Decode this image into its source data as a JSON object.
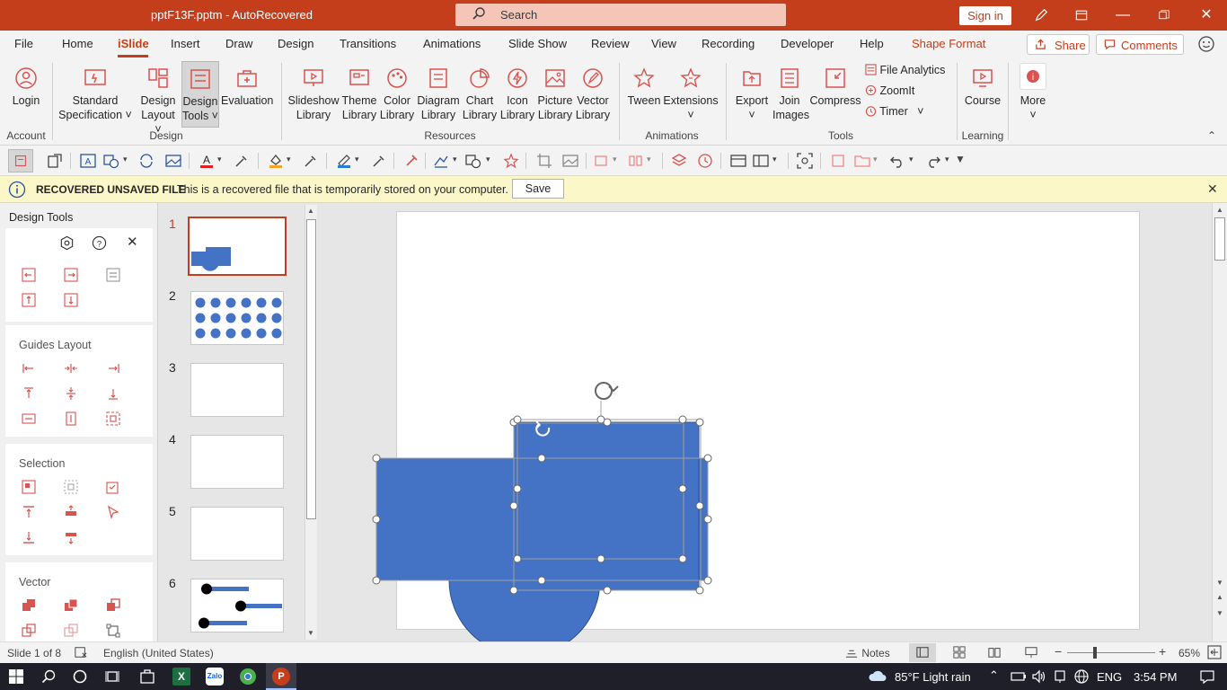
{
  "titlebar": {
    "doc_title": "pptF13F.pptm  -  AutoRecovered",
    "search_placeholder": "Search",
    "signin": "Sign in"
  },
  "tabs": [
    "File",
    "Home",
    "iSlide",
    "Insert",
    "Draw",
    "Design",
    "Transitions",
    "Animations",
    "Slide Show",
    "Review",
    "View",
    "Recording",
    "Developer",
    "Help",
    "Shape Format"
  ],
  "active_tab": "iSlide",
  "share_label": "Share",
  "comments_label": "Comments",
  "ribbon": {
    "login": "Login",
    "standard_spec": [
      "Standard",
      "Specification"
    ],
    "design_layout": [
      "Design",
      "Layout"
    ],
    "design_tools": [
      "Design",
      "Tools"
    ],
    "evaluation": "Evaluation",
    "slideshow_lib": [
      "Slideshow",
      "Library"
    ],
    "theme_lib": [
      "Theme",
      "Library"
    ],
    "color_lib": [
      "Color",
      "Library"
    ],
    "diagram_lib": [
      "Diagram",
      "Library"
    ],
    "chart_lib": [
      "Chart",
      "Library"
    ],
    "icon_lib": [
      "Icon",
      "Library"
    ],
    "picture_lib": [
      "Picture",
      "Library"
    ],
    "vector_lib": [
      "Vector",
      "Library"
    ],
    "tween": "Tween",
    "extensions": "Extensions",
    "export": "Export",
    "join_images": [
      "Join",
      "Images"
    ],
    "compress": "Compress",
    "file_analytics": "File Analytics",
    "zoomit": "ZoomIt",
    "timer": "Timer",
    "course": "Course",
    "more": "More",
    "groups": {
      "account": "Account",
      "design": "Design",
      "resources": "Resources",
      "animations": "Animations",
      "tools": "Tools",
      "learning": "Learning"
    }
  },
  "infobar": {
    "title": "RECOVERED UNSAVED FILE",
    "message": "This is a recovered file that is temporarily stored on your computer.",
    "save": "Save"
  },
  "design_tools_pane": {
    "title": "Design Tools",
    "sections": [
      "Guides Layout",
      "Selection",
      "Vector"
    ]
  },
  "slides": {
    "numbers": [
      "1",
      "2",
      "3",
      "4",
      "5",
      "6"
    ],
    "selected": 1
  },
  "statusbar": {
    "slide_info": "Slide 1 of 8",
    "language": "English (United States)",
    "notes": "Notes",
    "zoom": "65%"
  },
  "taskbar": {
    "weather": "85°F  Light rain",
    "lang": "ENG",
    "time": "3:54 PM"
  },
  "colors": {
    "accent": "#c43e1c",
    "shape_fill": "#4472c4"
  }
}
